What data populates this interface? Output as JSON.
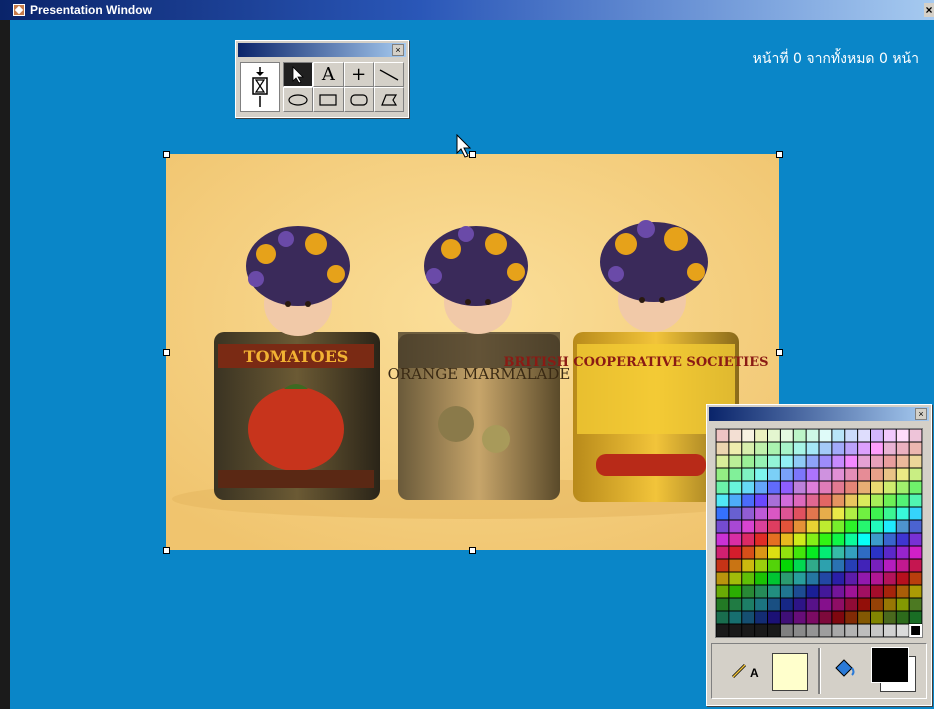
{
  "window": {
    "title": "Presentation Window",
    "close_glyph": "×"
  },
  "page_counter": "หน้าที่ 0 จากทั้งหมด 0 หน้า",
  "tool_palette": {
    "close_glyph": "×",
    "tools": [
      {
        "name": "arrow-tool",
        "icon": "arrow-pointer-icon"
      },
      {
        "name": "text-tool",
        "glyph": "A"
      },
      {
        "name": "cross-tool",
        "glyph": "+"
      },
      {
        "name": "line-tool",
        "icon": "line-icon"
      },
      {
        "name": "ellipse-tool",
        "icon": "ellipse-icon"
      },
      {
        "name": "rectangle-tool",
        "icon": "rectangle-icon"
      },
      {
        "name": "rounded-rect-tool",
        "icon": "rounded-rect-icon"
      },
      {
        "name": "polygon-tool",
        "icon": "polygon-icon"
      }
    ]
  },
  "image": {
    "description_icon": "photo-icon",
    "can_labels": [
      "TOMATOES",
      "ORANGE MARMALADE",
      "BRITISH COOPERATIVE SOCIETIES"
    ]
  },
  "color_palette": {
    "close_glyph": "×",
    "line_color": "#ffffcc",
    "fill_color": "#000000",
    "bg_color": "#ffffff",
    "text_label": "A"
  },
  "colors": {
    "desktop": "#0a86c8",
    "titlebar": "#0a246a"
  }
}
